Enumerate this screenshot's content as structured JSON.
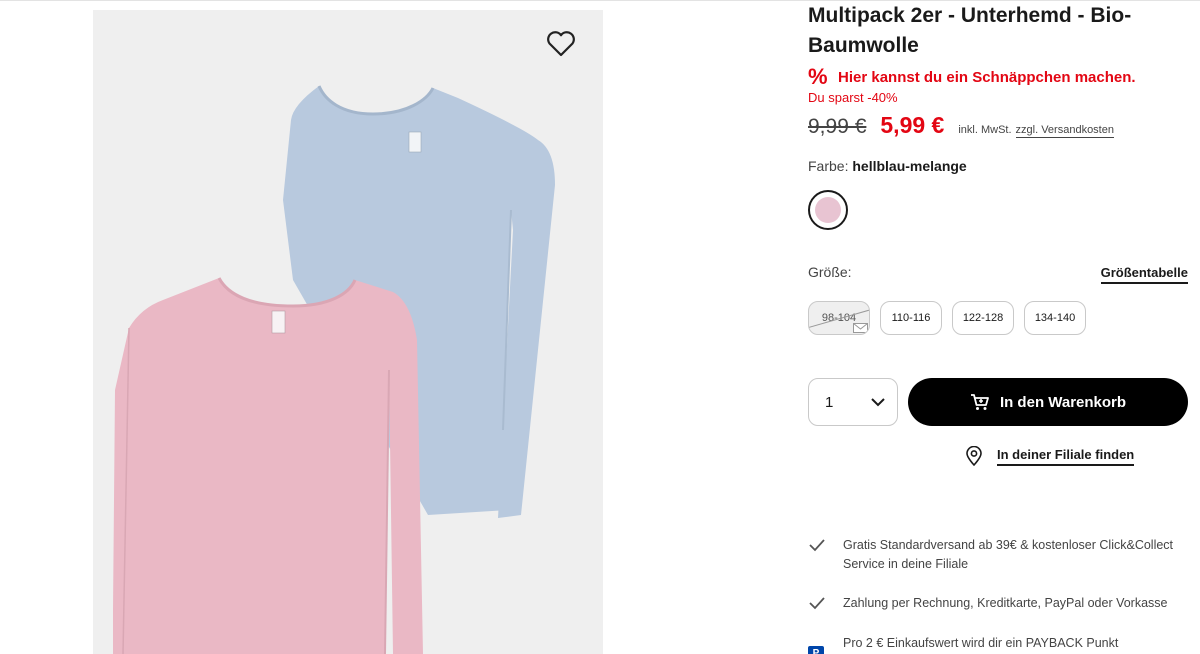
{
  "product": {
    "title": "Multipack 2er - Unterhemd - Bio-Baumwolle",
    "deal_icon": "%",
    "deal_text": "Hier kannst du ein Schnäppchen machen.",
    "savings_text": "Du sparst -40%",
    "old_price": "9,99 €",
    "new_price": "5,99 €",
    "tax_note": "inkl. MwSt.",
    "shipping_link": "zzgl. Versandkosten"
  },
  "color": {
    "label": "Farbe:",
    "value": "hellblau-melange",
    "swatch_hex": "#e8c4d2"
  },
  "size": {
    "label": "Größe:",
    "chart_link": "Größentabelle",
    "options": [
      {
        "label": "98-104",
        "available": false
      },
      {
        "label": "110-116",
        "available": true
      },
      {
        "label": "122-128",
        "available": true
      },
      {
        "label": "134-140",
        "available": true
      }
    ]
  },
  "cart": {
    "quantity": "1",
    "add_button": "In den Warenkorb"
  },
  "store": {
    "link": "In deiner Filiale finden"
  },
  "benefits": [
    {
      "icon": "check-icon",
      "text": "Gratis Standardversand ab 39€ & kostenloser Click&Collect Service in deine Filiale"
    },
    {
      "icon": "check-icon",
      "text": "Zahlung per Rechnung, Kreditkarte, PayPal oder Vorkasse"
    },
    {
      "icon": "payback-icon",
      "text": "Pro 2 € Einkaufswert wird dir ein PAYBACK Punkt"
    }
  ],
  "icons": {
    "wishlist": "heart-outline-icon",
    "cart": "shopping-cart-icon",
    "store": "location-pin-icon",
    "quantity": "chevron-down-icon"
  },
  "colors": {
    "accent": "#e30613",
    "button": "#000000",
    "image_bg": "#efefef",
    "shirt_blue": "#b8c9de",
    "shirt_pink": "#eab8c5"
  }
}
